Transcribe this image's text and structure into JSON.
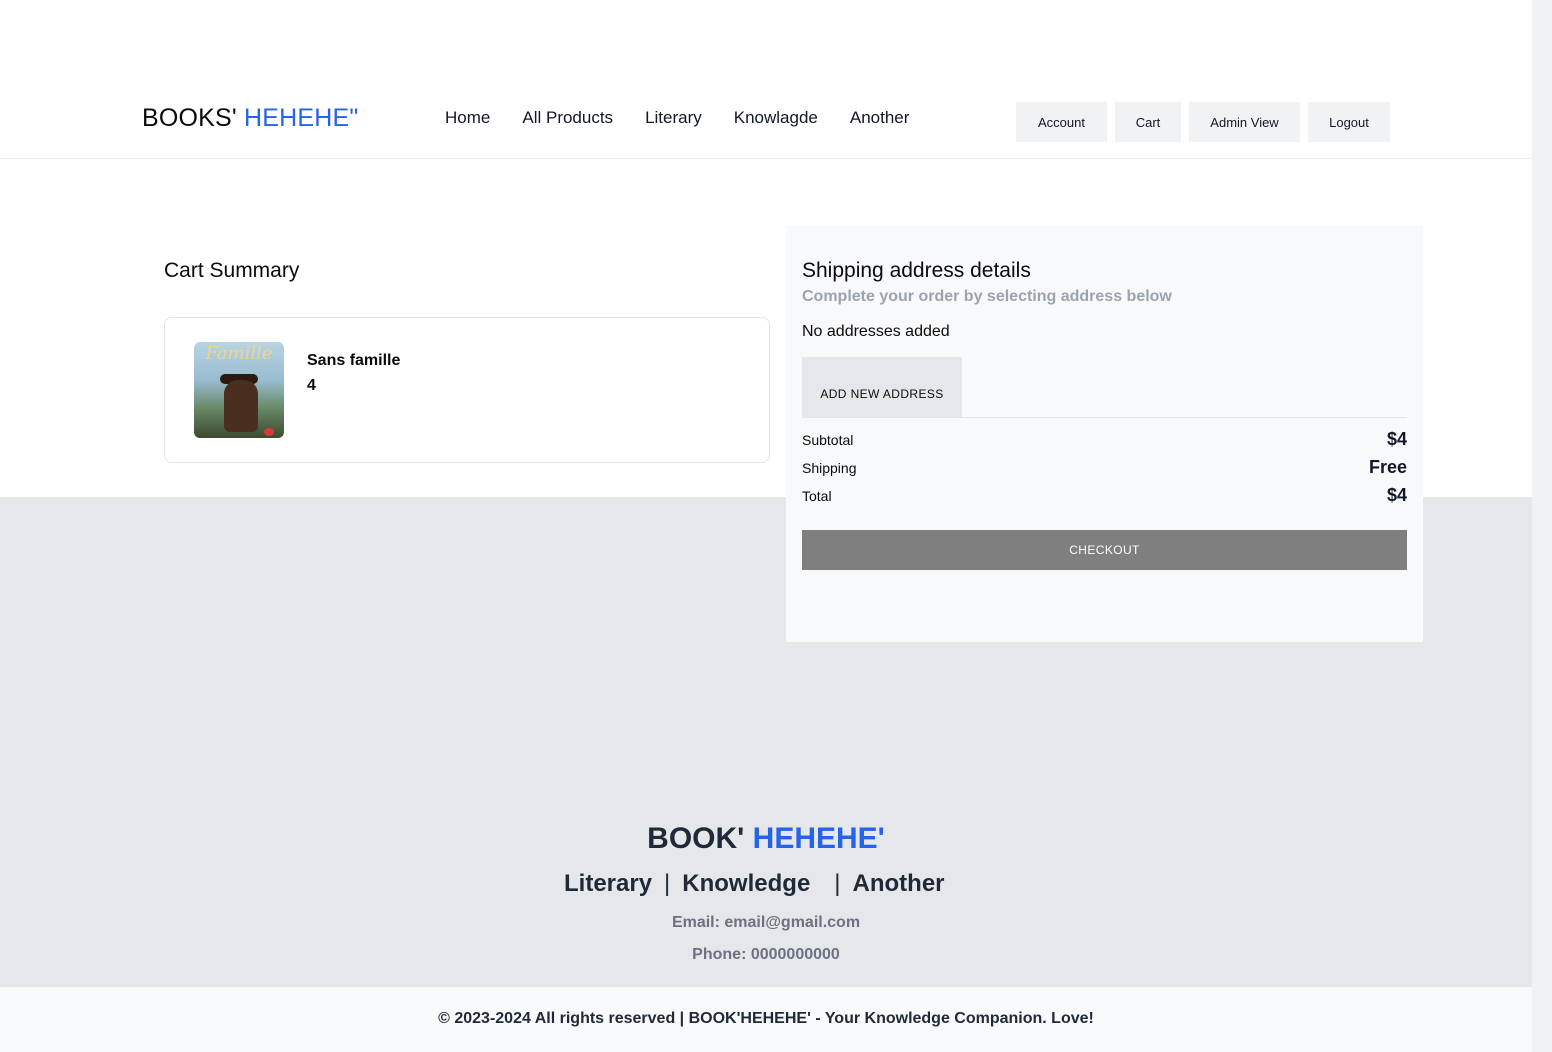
{
  "header": {
    "brand_part1": "BOOKS'",
    "brand_part2": "HEHEHE\"",
    "nav": [
      "Home",
      "All Products",
      "Literary",
      "Knowlagde",
      "Another"
    ],
    "buttons": {
      "account": "Account",
      "cart": "Cart",
      "admin": "Admin View",
      "logout": "Logout"
    }
  },
  "cart": {
    "title": "Cart Summary",
    "items": [
      {
        "cover_text": "Famille",
        "title": "Sans famille",
        "quantity": "4"
      }
    ]
  },
  "shipping": {
    "title": "Shipping address details",
    "subtitle": "Complete your order by selecting address below",
    "no_address": "No addresses added",
    "add_button": "ADD NEW ADDRESS",
    "subtotal_label": "Subtotal",
    "subtotal_value": "$4",
    "shipping_label": "Shipping",
    "shipping_value": "Free",
    "total_label": "Total",
    "total_value": "$4",
    "checkout_button": "CHECKOUT"
  },
  "footer": {
    "brand_part1": "BOOK'",
    "brand_part2": "HEHEHE'",
    "links": [
      "Literary",
      "Knowledge",
      "Another"
    ],
    "separator": "|",
    "email": "Email: email@gmail.com",
    "phone": "Phone: 0000000000",
    "copyright": "© 2023-2024 All rights reserved | BOOK'HEHEHE' - Your Knowledge Companion. Love!"
  },
  "colors": {
    "accent": "#2563eb",
    "checkout": "#7f7f7f",
    "footer_bg": "#e5e7eb"
  }
}
